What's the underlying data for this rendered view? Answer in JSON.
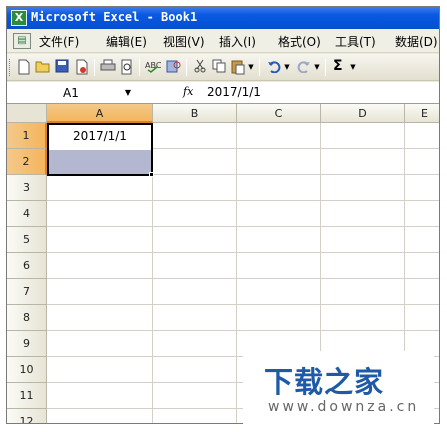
{
  "window": {
    "title": "Microsoft Excel - Book1",
    "app_icon_letter": "X"
  },
  "menu": [
    {
      "label": "文件(F)"
    },
    {
      "label": "编辑(E)"
    },
    {
      "label": "视图(V)"
    },
    {
      "label": "插入(I)"
    },
    {
      "label": "格式(O)"
    },
    {
      "label": "工具(T)"
    },
    {
      "label": "数据(D)"
    }
  ],
  "toolbar": {
    "buttons": [
      "new-icon",
      "open-icon",
      "save-icon",
      "permission-icon",
      "print-icon",
      "print-preview-icon",
      "spelling-icon",
      "research-icon",
      "cut-icon",
      "copy-icon",
      "paste-icon",
      "undo-icon",
      "redo-icon",
      "autosum-icon"
    ],
    "autosum_glyph": "Σ"
  },
  "formula_bar": {
    "name_box": "A1",
    "fx_label": "fx",
    "value": "2017/1/1"
  },
  "sheet": {
    "columns": [
      "A",
      "B",
      "C",
      "D",
      "E"
    ],
    "rows": [
      "1",
      "2",
      "3",
      "4",
      "5",
      "6",
      "7",
      "8",
      "9",
      "10",
      "11",
      "12"
    ],
    "active_column": "A",
    "active_rows": [
      "1",
      "2"
    ],
    "cells": {
      "A1": "2017/1/1",
      "A2": ""
    },
    "selection_fill_color": "#b3b7cf"
  },
  "watermark": {
    "logo_text": "下载之家",
    "url": "www.downza.cn",
    "color": "#1f5aa6"
  }
}
